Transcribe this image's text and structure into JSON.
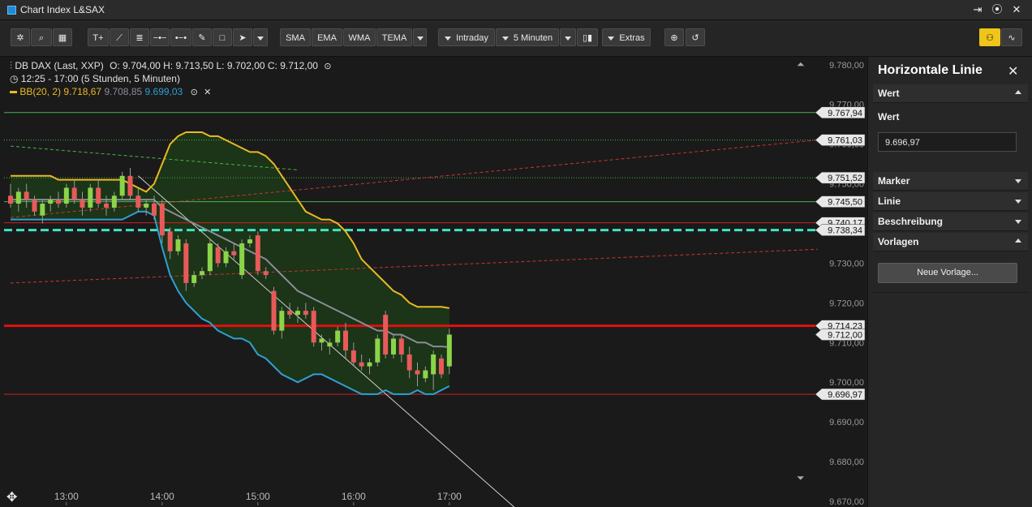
{
  "window": {
    "title": "Chart Index L&SAX",
    "controls": [
      "export-icon",
      "record-icon",
      "close-icon"
    ]
  },
  "toolbar": {
    "draw_tools": [
      "settings-icon",
      "zoom-search-icon",
      "grid-layout-icon",
      "text-tool-icon",
      "trendline-tool-icon",
      "fibonacci-tool-icon",
      "horizontal-line-tool-icon",
      "ray-tool-icon",
      "pencil-tool-icon",
      "rectangle-tool-icon",
      "cursor-tool-icon",
      "more-tools-caret"
    ],
    "indicators": [
      "SMA",
      "EMA",
      "WMA",
      "TEMA"
    ],
    "period": "Intraday",
    "interval": "5 Minuten",
    "extras": "Extras"
  },
  "legend": {
    "instrument": "DB DAX (Last, XXP)",
    "ohlc": "O: 9.704,00  H: 9.713,50  L: 9.702,00  C: 9.712,00",
    "timerange": "12:25 - 17:00 (5 Stunden, 5 Minuten)",
    "bb_label": "BB(20, 2)",
    "bb_upper": "9.718,67",
    "bb_mid": "9.708,85",
    "bb_lower": "9.699,03"
  },
  "colors": {
    "bb_upper": "#e8b923",
    "bb_mid": "#8c8c99",
    "bb_lower": "#2fa0d4",
    "up": "#8bd449",
    "down": "#e85a5a",
    "accent": "#f0c419"
  },
  "chart_data": {
    "type": "candlestick",
    "ylim": [
      9670,
      9782
    ],
    "y_ticks": [
      "9.780,00",
      "9.770,00",
      "9.760,00",
      "9.750,00",
      "9.740,00",
      "9.730,00",
      "9.720,00",
      "9.710,00",
      "9.700,00",
      "9.690,00",
      "9.680,00",
      "9.670,00"
    ],
    "x_ticks": [
      "13:00",
      "14:00",
      "15:00",
      "16:00",
      "17:00"
    ],
    "candles": [
      {
        "t": "12:25",
        "o": 9747.0,
        "h": 9750.0,
        "l": 9744.0,
        "c": 9745.0
      },
      {
        "t": "12:30",
        "o": 9745.0,
        "h": 9749.0,
        "l": 9743.0,
        "c": 9748.0
      },
      {
        "t": "12:35",
        "o": 9748.0,
        "h": 9750.0,
        "l": 9744.0,
        "c": 9746.0
      },
      {
        "t": "12:40",
        "o": 9746.0,
        "h": 9747.0,
        "l": 9742.0,
        "c": 9743.0
      },
      {
        "t": "12:45",
        "o": 9742.0,
        "h": 9746.0,
        "l": 9740.0,
        "c": 9745.0
      },
      {
        "t": "12:50",
        "o": 9745.0,
        "h": 9747.0,
        "l": 9743.0,
        "c": 9746.0
      },
      {
        "t": "12:55",
        "o": 9746.0,
        "h": 9748.0,
        "l": 9744.0,
        "c": 9745.0
      },
      {
        "t": "13:00",
        "o": 9745.0,
        "h": 9750.0,
        "l": 9744.0,
        "c": 9749.0
      },
      {
        "t": "13:05",
        "o": 9749.0,
        "h": 9751.0,
        "l": 9745.0,
        "c": 9746.0
      },
      {
        "t": "13:10",
        "o": 9746.0,
        "h": 9748.0,
        "l": 9742.0,
        "c": 9744.0
      },
      {
        "t": "13:15",
        "o": 9744.0,
        "h": 9750.0,
        "l": 9743.0,
        "c": 9749.0
      },
      {
        "t": "13:20",
        "o": 9749.0,
        "h": 9751.0,
        "l": 9744.0,
        "c": 9745.0
      },
      {
        "t": "13:25",
        "o": 9745.0,
        "h": 9747.0,
        "l": 9742.0,
        "c": 9744.0
      },
      {
        "t": "13:30",
        "o": 9744.0,
        "h": 9748.0,
        "l": 9743.0,
        "c": 9747.0
      },
      {
        "t": "13:35",
        "o": 9747.0,
        "h": 9753.0,
        "l": 9746.0,
        "c": 9752.0
      },
      {
        "t": "13:40",
        "o": 9752.0,
        "h": 9754.0,
        "l": 9746.0,
        "c": 9747.0
      },
      {
        "t": "13:45",
        "o": 9747.0,
        "h": 9749.0,
        "l": 9743.0,
        "c": 9744.0
      },
      {
        "t": "13:50",
        "o": 9744.0,
        "h": 9746.0,
        "l": 9742.0,
        "c": 9745.0
      },
      {
        "t": "13:55",
        "o": 9745.0,
        "h": 9747.0,
        "l": 9741.0,
        "c": 9742.0
      },
      {
        "t": "14:00",
        "o": 9745.0,
        "h": 9746.0,
        "l": 9735.0,
        "c": 9737.0
      },
      {
        "t": "14:05",
        "o": 9738.0,
        "h": 9739.0,
        "l": 9731.0,
        "c": 9733.0
      },
      {
        "t": "14:10",
        "o": 9733.0,
        "h": 9737.0,
        "l": 9732.0,
        "c": 9736.0
      },
      {
        "t": "14:15",
        "o": 9735.0,
        "h": 9736.0,
        "l": 9723.0,
        "c": 9725.0
      },
      {
        "t": "14:20",
        "o": 9725.0,
        "h": 9728.0,
        "l": 9724.0,
        "c": 9727.0
      },
      {
        "t": "14:25",
        "o": 9727.0,
        "h": 9729.0,
        "l": 9726.0,
        "c": 9728.0
      },
      {
        "t": "14:30",
        "o": 9728.0,
        "h": 9736.0,
        "l": 9727.0,
        "c": 9735.0
      },
      {
        "t": "14:35",
        "o": 9734.0,
        "h": 9735.0,
        "l": 9729.0,
        "c": 9730.0
      },
      {
        "t": "14:40",
        "o": 9730.0,
        "h": 9734.0,
        "l": 9729.0,
        "c": 9733.0
      },
      {
        "t": "14:45",
        "o": 9733.0,
        "h": 9735.0,
        "l": 9731.0,
        "c": 9732.0
      },
      {
        "t": "14:50",
        "o": 9727.0,
        "h": 9736.0,
        "l": 9726.0,
        "c": 9735.0
      },
      {
        "t": "14:55",
        "o": 9735.0,
        "h": 9737.0,
        "l": 9734.0,
        "c": 9736.0
      },
      {
        "t": "15:00",
        "o": 9737.0,
        "h": 9738.0,
        "l": 9727.0,
        "c": 9728.0
      },
      {
        "t": "15:05",
        "o": 9728.0,
        "h": 9729.0,
        "l": 9726.0,
        "c": 9727.0
      },
      {
        "t": "15:10",
        "o": 9723.0,
        "h": 9724.0,
        "l": 9712.0,
        "c": 9713.0
      },
      {
        "t": "15:15",
        "o": 9713.0,
        "h": 9719.0,
        "l": 9711.0,
        "c": 9718.0
      },
      {
        "t": "15:20",
        "o": 9718.0,
        "h": 9720.0,
        "l": 9716.0,
        "c": 9717.0
      },
      {
        "t": "15:25",
        "o": 9717.0,
        "h": 9719.0,
        "l": 9715.0,
        "c": 9718.0
      },
      {
        "t": "15:30",
        "o": 9718.0,
        "h": 9720.0,
        "l": 9716.0,
        "c": 9717.0
      },
      {
        "t": "15:35",
        "o": 9718.0,
        "h": 9719.0,
        "l": 9709.0,
        "c": 9710.0
      },
      {
        "t": "15:40",
        "o": 9710.0,
        "h": 9712.0,
        "l": 9708.0,
        "c": 9711.0
      },
      {
        "t": "15:45",
        "o": 9709.0,
        "h": 9711.0,
        "l": 9707.0,
        "c": 9710.0
      },
      {
        "t": "15:50",
        "o": 9710.0,
        "h": 9714.0,
        "l": 9709.0,
        "c": 9713.0
      },
      {
        "t": "15:55",
        "o": 9713.0,
        "h": 9715.0,
        "l": 9706.0,
        "c": 9708.0
      },
      {
        "t": "16:00",
        "o": 9708.0,
        "h": 9710.0,
        "l": 9704.0,
        "c": 9705.0
      },
      {
        "t": "16:05",
        "o": 9705.0,
        "h": 9707.0,
        "l": 9703.0,
        "c": 9704.0
      },
      {
        "t": "16:10",
        "o": 9704.0,
        "h": 9706.0,
        "l": 9702.0,
        "c": 9705.0
      },
      {
        "t": "16:15",
        "o": 9705.0,
        "h": 9712.0,
        "l": 9704.0,
        "c": 9711.0
      },
      {
        "t": "16:20",
        "o": 9717.0,
        "h": 9718.0,
        "l": 9706.0,
        "c": 9707.0
      },
      {
        "t": "16:25",
        "o": 9707.0,
        "h": 9712.0,
        "l": 9706.0,
        "c": 9711.0
      },
      {
        "t": "16:30",
        "o": 9711.0,
        "h": 9712.0,
        "l": 9705.0,
        "c": 9707.0
      },
      {
        "t": "16:35",
        "o": 9707.0,
        "h": 9709.0,
        "l": 9701.0,
        "c": 9703.0
      },
      {
        "t": "16:40",
        "o": 9703.0,
        "h": 9705.0,
        "l": 9699.0,
        "c": 9702.0
      },
      {
        "t": "16:45",
        "o": 9701.0,
        "h": 9704.0,
        "l": 9700.0,
        "c": 9703.0
      },
      {
        "t": "16:50",
        "o": 9702.0,
        "h": 9708.0,
        "l": 9698.0,
        "c": 9707.0
      },
      {
        "t": "16:55",
        "o": 9706.0,
        "h": 9707.0,
        "l": 9701.0,
        "c": 9702.0
      },
      {
        "t": "17:00",
        "o": 9704.0,
        "h": 9713.5,
        "l": 9702.0,
        "c": 9712.0
      }
    ],
    "bb_upper": [
      9752,
      9752,
      9752,
      9752,
      9752,
      9752,
      9751,
      9751,
      9751,
      9751,
      9751,
      9751,
      9751,
      9751,
      9751,
      9750,
      9749,
      9748,
      9750,
      9755,
      9760,
      9762,
      9763,
      9763,
      9763,
      9762,
      9762,
      9761,
      9760,
      9759,
      9758,
      9758,
      9757,
      9755,
      9752,
      9749,
      9746,
      9743,
      9742,
      9741,
      9741,
      9740,
      9738,
      9735,
      9731,
      9729,
      9727,
      9725,
      9723,
      9722,
      9720,
      9719,
      9719,
      9719,
      9719,
      9718.67
    ],
    "bb_mid": [
      9746,
      9746,
      9746,
      9746,
      9746,
      9746,
      9746,
      9746,
      9746,
      9746,
      9746,
      9746,
      9746,
      9746,
      9746,
      9746,
      9746,
      9746,
      9746,
      9744,
      9743,
      9742,
      9741,
      9740,
      9739,
      9738,
      9737,
      9736,
      9735,
      9734,
      9733,
      9732,
      9731,
      9729,
      9727,
      9725,
      9723,
      9722,
      9721,
      9720,
      9719,
      9718,
      9717,
      9716,
      9715,
      9714,
      9713,
      9713,
      9712,
      9712,
      9711,
      9710,
      9710,
      9709,
      9709,
      9708.85
    ],
    "bb_lower": [
      9741,
      9741,
      9741,
      9741,
      9741,
      9741,
      9741,
      9741,
      9741,
      9741,
      9741,
      9741,
      9741,
      9741,
      9741,
      9742,
      9743,
      9743,
      9742,
      9734,
      9727,
      9723,
      9720,
      9718,
      9716,
      9715,
      9713,
      9712,
      9711,
      9711,
      9710,
      9707,
      9706,
      9704,
      9702,
      9701,
      9700,
      9701,
      9702,
      9702,
      9701,
      9700,
      9699,
      9698,
      9697,
      9697,
      9697,
      9698,
      9697,
      9697,
      9697,
      9698,
      9697,
      9697,
      9698,
      9699.03
    ],
    "hlines": [
      {
        "value": 9767.94,
        "label": "9.767,94",
        "color": "#4caf50",
        "style": "solid"
      },
      {
        "value": 9761.03,
        "label": "9.761,03",
        "color": "#4caf50",
        "style": "dotted"
      },
      {
        "value": 9751.52,
        "label": "9.751,52",
        "color": "#4caf50",
        "style": "dotted"
      },
      {
        "value": 9745.5,
        "label": "9.745,50",
        "color": "#4caf50",
        "style": "solid"
      },
      {
        "value": 9740.17,
        "label": "9.740,17",
        "color": "#cc2222",
        "style": "solid"
      },
      {
        "value": 9738.34,
        "label": "9.738,34",
        "color": "#3ee6c4",
        "style": "dashed"
      },
      {
        "value": 9714.23,
        "label": "9.714,23",
        "color": "#e01010",
        "style": "solid"
      },
      {
        "value": 9712.0,
        "label": "9.712,00",
        "color": "#888888",
        "style": "none"
      },
      {
        "value": 9696.97,
        "label": "9.696,97",
        "color": "#cc2222",
        "style": "solid"
      }
    ],
    "trendlines": [
      {
        "from": [
          "12:25",
          9741.5
        ],
        "to": [
          "end",
          9761.03
        ],
        "color": "#cc3333",
        "style": "dashed"
      },
      {
        "from": [
          "12:25",
          9725.0
        ],
        "to": [
          "end",
          9733.5
        ],
        "color": "#cc3333",
        "style": "dashed"
      },
      {
        "from": [
          "12:25",
          9759.5
        ],
        "to": [
          "15:25",
          9753.5
        ],
        "color": "#44b844",
        "style": "dashed"
      },
      {
        "from": [
          "13:45",
          9752.0
        ],
        "to": [
          "17:45",
          9667.0
        ],
        "color": "#cfcfcf",
        "style": "solid"
      }
    ]
  },
  "panel": {
    "title": "Horizontale Linie",
    "sections": {
      "wert": "Wert",
      "marker": "Marker",
      "linie": "Linie",
      "beschreibung": "Beschreibung",
      "vorlagen": "Vorlagen"
    },
    "wert_label": "Wert",
    "wert_value": "9.696,97",
    "new_template_button": "Neue Vorlage..."
  }
}
